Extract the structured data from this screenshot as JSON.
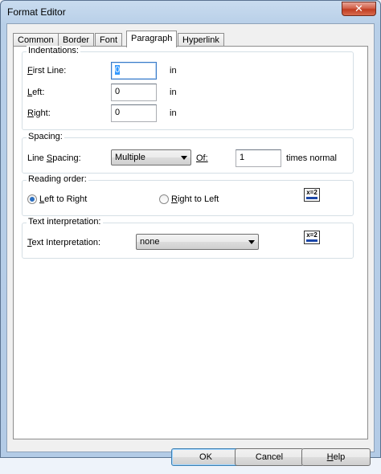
{
  "window": {
    "title": "Format Editor",
    "close_glyph": "✕"
  },
  "tabs": [
    "Common",
    "Border",
    "Font",
    "Paragraph",
    "Hyperlink"
  ],
  "active_tab": "Paragraph",
  "indentations": {
    "group_label": "Indentations:",
    "first_line": {
      "label_key": "F",
      "label_rest": "irst Line:",
      "value": "0",
      "unit": "in"
    },
    "left": {
      "label_key": "L",
      "label_rest": "eft:",
      "value": "0",
      "unit": "in"
    },
    "right": {
      "label_key": "R",
      "label_rest": "ight:",
      "value": "0",
      "unit": "in"
    }
  },
  "spacing": {
    "group_label": "Spacing:",
    "line_spacing_label_pre": "Line ",
    "line_spacing_label_key": "S",
    "line_spacing_label_post": "pacing:",
    "line_spacing_value": "Multiple",
    "of_label": "Of:",
    "of_value": "1",
    "of_unit": "times normal"
  },
  "reading_order": {
    "group_label": "Reading order:",
    "ltr_pre": "",
    "ltr_key": "L",
    "ltr_post": "eft to Right",
    "rtl_pre": "",
    "rtl_key": "R",
    "rtl_post": "ight to Left",
    "selected": "Left to Right",
    "expr_icon": "x-equals-2-icon",
    "icon_text": "x=2"
  },
  "text_interpretation": {
    "group_label": "Text interpretation:",
    "label_key": "T",
    "label_rest": "ext Interpretation:",
    "value": "none",
    "expr_icon": "x-equals-2-icon",
    "icon_text": "x=2"
  },
  "buttons": {
    "ok": "OK",
    "cancel": "Cancel",
    "help_key": "H",
    "help_rest": "elp"
  }
}
